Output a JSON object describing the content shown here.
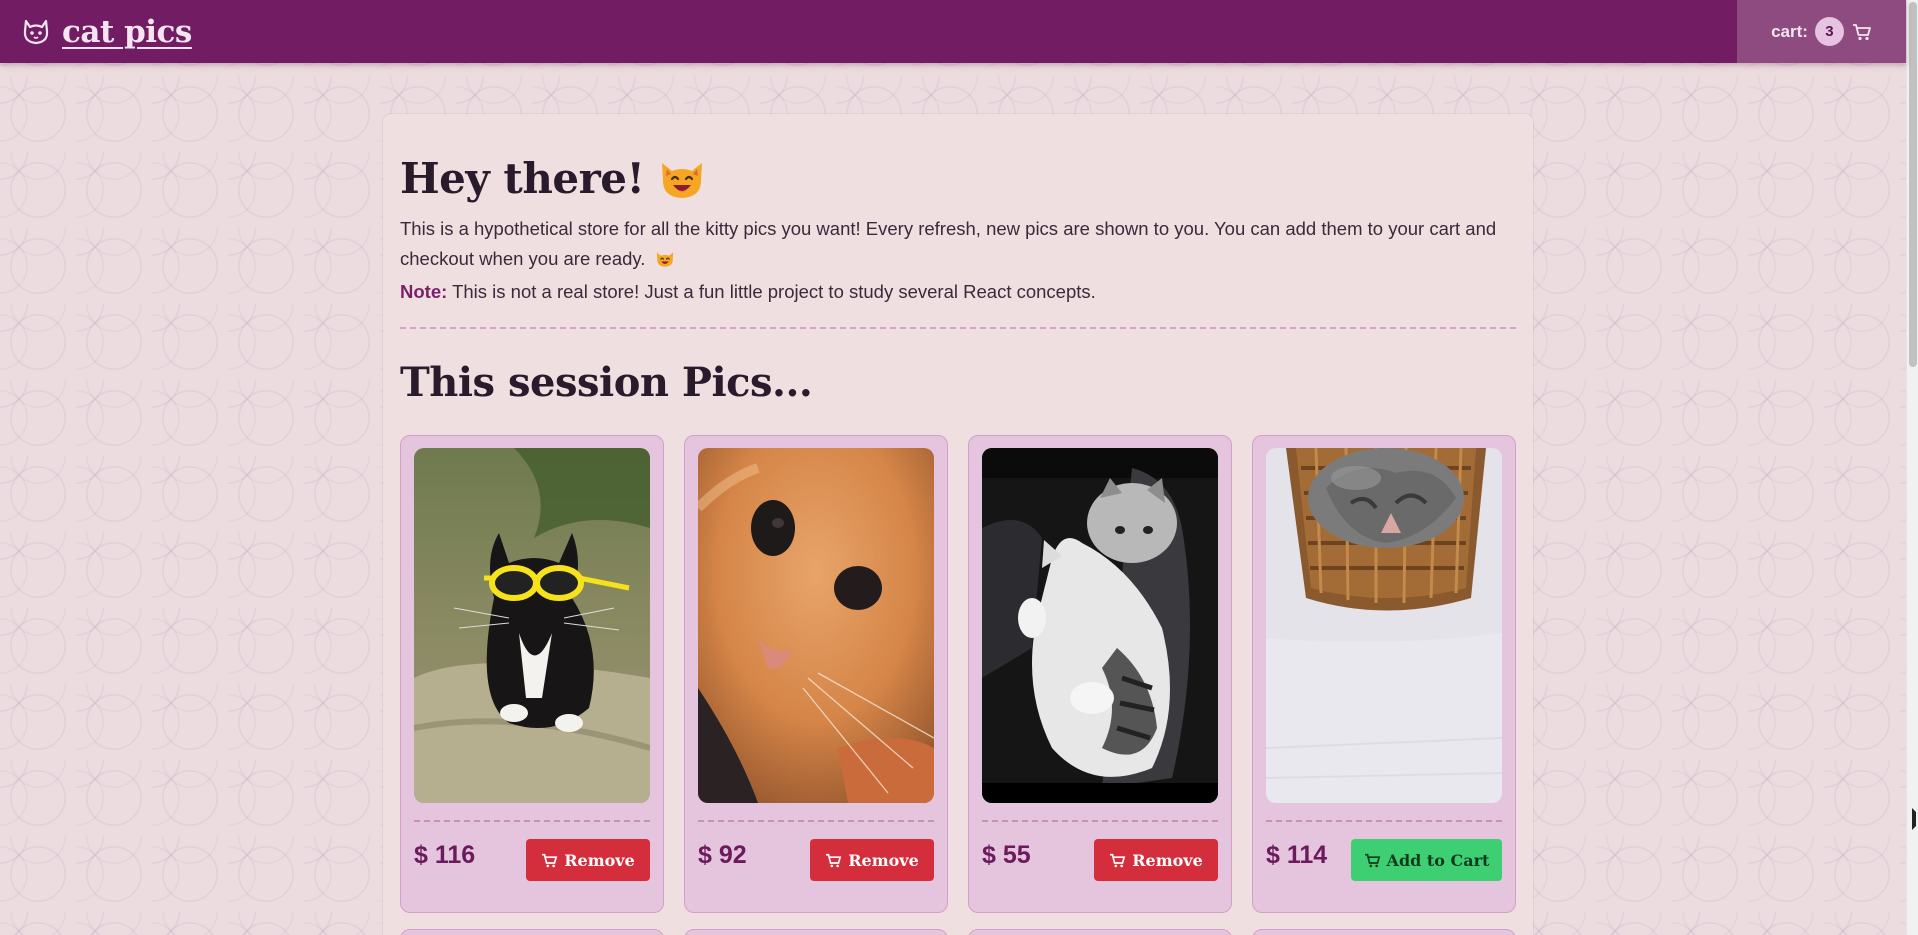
{
  "header": {
    "brand_title": "cat pics",
    "cart_label": "cart:",
    "cart_count": "3",
    "bg_color": "#721d63",
    "brand_icon": "cat-face-icon",
    "cart_icon": "shopping-cart-icon"
  },
  "intro": {
    "greeting": "Hey there!",
    "greeting_emoji": "smiling-cat-icon",
    "text_1": "This is a hypothetical store for all the kitty pics you want! Every refresh, new pics are shown to you. You can add them to your cart and checkout when you are ready.",
    "note_label": "Note:",
    "note_text": "This is not a real store! Just a fun little project to study several React concepts."
  },
  "section": {
    "title": "This session Pics..."
  },
  "products": [
    {
      "price": "$ 116",
      "action": "Remove",
      "in_cart": true,
      "image": "black-white-cat-with-yellow-sunglasses"
    },
    {
      "price": "$ 92",
      "action": "Remove",
      "in_cart": true,
      "image": "orange-kitten-closeup"
    },
    {
      "price": "$ 55",
      "action": "Remove",
      "in_cart": true,
      "image": "two-grey-white-kittens-cuddling"
    },
    {
      "price": "$ 114",
      "action": "Add to Cart",
      "in_cart": false,
      "image": "tabby-kitten-in-wicker-basket"
    }
  ],
  "colors": {
    "accent": "#721d63",
    "remove_button": "#d42e3c",
    "add_button": "#3ecf73",
    "card_bg": "#e5c5dd"
  }
}
